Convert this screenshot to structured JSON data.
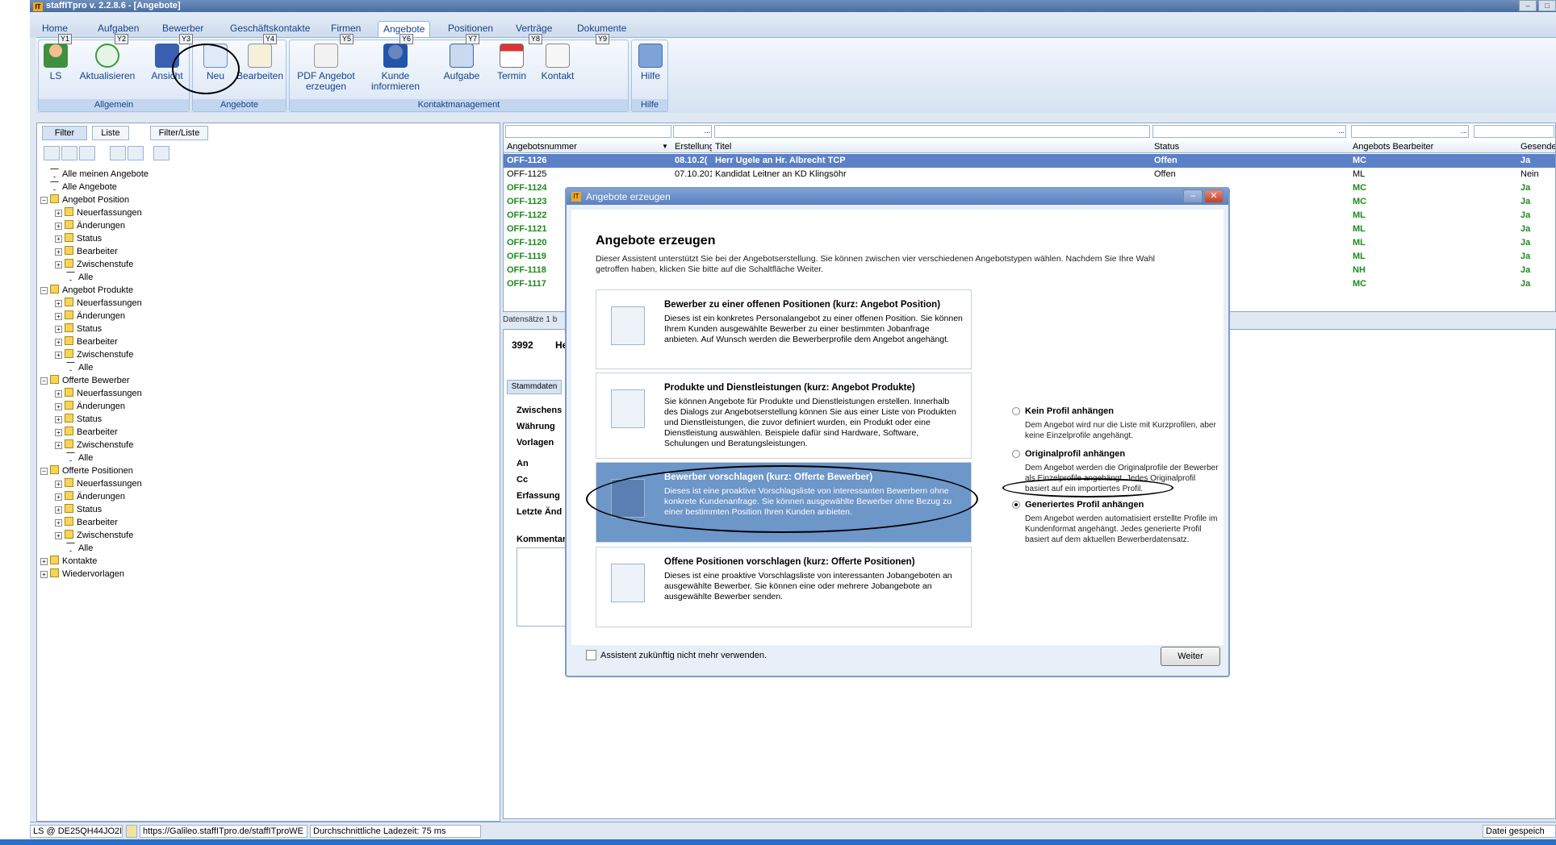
{
  "app": {
    "title": "staffITpro v. 2.2.8.6 - [Angebote]",
    "logo": "IT",
    "window_buttons": [
      "–",
      "□"
    ]
  },
  "menu": [
    "Home",
    "Aufgaben",
    "Bewerber",
    "Geschäftskontakte",
    "Firmen",
    "Angebote",
    "Positionen",
    "Verträge",
    "Dokumente"
  ],
  "menu_active": "Angebote",
  "ribbon": {
    "groups": [
      "Allgemein",
      "Angebote",
      "Kontaktmanagement",
      "Hilfe"
    ],
    "buttons": [
      {
        "label": "LS",
        "icon": "user-icon",
        "key": "Y1"
      },
      {
        "label": "Aktualisieren",
        "icon": "refresh-icon",
        "key": "Y2"
      },
      {
        "label": "Ansicht",
        "icon": "view-icon",
        "key": "Y3"
      },
      {
        "label": "Neu",
        "icon": "new-icon"
      },
      {
        "label": "Bearbeiten",
        "icon": "edit-icon",
        "key": "Y4"
      },
      {
        "label": "PDF Angebot erzeugen",
        "icon": "pdf-icon",
        "key": "Y5"
      },
      {
        "label": "Kunde informieren",
        "icon": "info-user-icon",
        "key": "Y6"
      },
      {
        "label": "Aufgabe",
        "icon": "task-icon",
        "key": "Y7"
      },
      {
        "label": "Termin",
        "icon": "calendar-icon",
        "key": "Y8"
      },
      {
        "label": "Kontakt",
        "icon": "contact-icon"
      },
      {
        "label": "Hilfe",
        "icon": "help-icon",
        "key": "Y9"
      }
    ]
  },
  "left": {
    "tabs": [
      "Filter",
      "Liste",
      "Filter/Liste"
    ],
    "tree": [
      {
        "label": "Alle meinen Angebote",
        "level": 0,
        "type": "funnel"
      },
      {
        "label": "Alle Angebote",
        "level": 0,
        "type": "funnel"
      },
      {
        "label": "Angebot Position",
        "level": 0,
        "type": "folder",
        "toggle": "−"
      },
      {
        "label": "Neuerfassungen",
        "level": 1,
        "type": "folder",
        "toggle": "+"
      },
      {
        "label": "Änderungen",
        "level": 1,
        "type": "folder",
        "toggle": "+"
      },
      {
        "label": "Status",
        "level": 1,
        "type": "folder",
        "toggle": "+"
      },
      {
        "label": "Bearbeiter",
        "level": 1,
        "type": "folder",
        "toggle": "+"
      },
      {
        "label": "Zwischenstufe",
        "level": 1,
        "type": "folder",
        "toggle": "+"
      },
      {
        "label": "Alle",
        "level": 1,
        "type": "funnel"
      },
      {
        "label": "Angebot Produkte",
        "level": 0,
        "type": "folder",
        "toggle": "−"
      },
      {
        "label": "Neuerfassungen",
        "level": 1,
        "type": "folder",
        "toggle": "+"
      },
      {
        "label": "Änderungen",
        "level": 1,
        "type": "folder",
        "toggle": "+"
      },
      {
        "label": "Status",
        "level": 1,
        "type": "folder",
        "toggle": "+"
      },
      {
        "label": "Bearbeiter",
        "level": 1,
        "type": "folder",
        "toggle": "+"
      },
      {
        "label": "Zwischenstufe",
        "level": 1,
        "type": "folder",
        "toggle": "+"
      },
      {
        "label": "Alle",
        "level": 1,
        "type": "funnel"
      },
      {
        "label": "Offerte Bewerber",
        "level": 0,
        "type": "folder",
        "toggle": "−"
      },
      {
        "label": "Neuerfassungen",
        "level": 1,
        "type": "folder",
        "toggle": "+"
      },
      {
        "label": "Änderungen",
        "level": 1,
        "type": "folder",
        "toggle": "+"
      },
      {
        "label": "Status",
        "level": 1,
        "type": "folder",
        "toggle": "+"
      },
      {
        "label": "Bearbeiter",
        "level": 1,
        "type": "folder",
        "toggle": "+"
      },
      {
        "label": "Zwischenstufe",
        "level": 1,
        "type": "folder",
        "toggle": "+"
      },
      {
        "label": "Alle",
        "level": 1,
        "type": "funnel"
      },
      {
        "label": "Offerte Positionen",
        "level": 0,
        "type": "folder",
        "toggle": "−"
      },
      {
        "label": "Neuerfassungen",
        "level": 1,
        "type": "folder",
        "toggle": "+"
      },
      {
        "label": "Änderungen",
        "level": 1,
        "type": "folder",
        "toggle": "+"
      },
      {
        "label": "Status",
        "level": 1,
        "type": "folder",
        "toggle": "+"
      },
      {
        "label": "Bearbeiter",
        "level": 1,
        "type": "folder",
        "toggle": "+"
      },
      {
        "label": "Zwischenstufe",
        "level": 1,
        "type": "folder",
        "toggle": "+"
      },
      {
        "label": "Alle",
        "level": 1,
        "type": "funnel"
      },
      {
        "label": "Kontakte",
        "level": 0,
        "type": "folder",
        "toggle": "+"
      },
      {
        "label": "Wiedervorlagen",
        "level": 0,
        "type": "folder",
        "toggle": "+"
      }
    ]
  },
  "grid": {
    "filter_button": "...",
    "headers": [
      "Angebotsnummer",
      "Erstellung",
      "Titel",
      "Status",
      "Angebots Bearbeiter",
      "Gesende"
    ],
    "rows": [
      {
        "nr": "OFF-1126",
        "date": "08.10.2(",
        "title": "Herr Ugele an Hr. Albrecht TCP",
        "status": "Offen",
        "bearb": "MC",
        "ges": "Ja",
        "style": "sel"
      },
      {
        "nr": "OFF-1125",
        "date": "07.10.201",
        "title": "Kandidat Leitner an KD Klingsöhr",
        "status": "Offen",
        "bearb": "ML",
        "ges": "Nein",
        "style": "plain"
      },
      {
        "nr": "OFF-1124",
        "date": "",
        "title": "",
        "status": "",
        "bearb": "MC",
        "ges": "Ja",
        "style": "green"
      },
      {
        "nr": "OFF-1123",
        "date": "",
        "title": "",
        "status": "",
        "bearb": "MC",
        "ges": "Ja",
        "style": "green"
      },
      {
        "nr": "OFF-1122",
        "date": "",
        "title": "",
        "status": "",
        "bearb": "ML",
        "ges": "Ja",
        "style": "green"
      },
      {
        "nr": "OFF-1121",
        "date": "",
        "title": "",
        "status": "",
        "bearb": "ML",
        "ges": "Ja",
        "style": "green"
      },
      {
        "nr": "OFF-1120",
        "date": "",
        "title": "",
        "status": "",
        "bearb": "ML",
        "ges": "Ja",
        "style": "green"
      },
      {
        "nr": "OFF-1119",
        "date": "",
        "title": "",
        "status": "",
        "bearb": "ML",
        "ges": "Ja",
        "style": "green"
      },
      {
        "nr": "OFF-1118",
        "date": "",
        "title": "",
        "status": "",
        "bearb": "NH",
        "ges": "Ja",
        "style": "green"
      },
      {
        "nr": "OFF-1117",
        "date": "",
        "title": "",
        "status": "",
        "bearb": "MC",
        "ges": "Ja",
        "style": "green"
      }
    ],
    "footer": "Datensätze 1 b"
  },
  "detail": {
    "id": "3992",
    "name": "He",
    "tab": "Stammdaten",
    "labels": [
      "Zwischens",
      "Währung",
      "Vorlagen",
      "An",
      "Cc",
      "Erfassung",
      "Letzte Änd",
      "Kommentar"
    ]
  },
  "status": {
    "user": "LS @ DE25QH44JO2I",
    "url": "https://Galileo.staffITpro.de/staffITproWE",
    "load": "Durchschnittliche Ladezeit: 75 ms",
    "saved": "Datei gespeich"
  },
  "dialog": {
    "title": "Angebote erzeugen",
    "heading": "Angebote erzeugen",
    "intro": "Dieser Assistent unterstützt Sie bei der Angebotserstellung. Sie können zwischen vier verschiedenen Angebotstypen wählen. Nachdem Sie Ihre Wahl getroffen haben, klicken Sie bitte auf die Schaltfläche Weiter.",
    "options": [
      {
        "title": "Bewerber zu einer offenen Positionen (kurz: Angebot Position)",
        "desc": "Dieses ist ein konkretes Personalangebot zu einer offenen Position. Sie können Ihrem Kunden ausgewählte Bewerber zu einer bestimmten Jobanfrage anbieten. Auf Wunsch werden die Bewerberprofile dem Angebot angehängt."
      },
      {
        "title": "Produkte und Dienstleistungen (kurz: Angebot Produkte)",
        "desc": "Sie können Angebote für Produkte und Dienstleistungen erstellen. Innerhalb des Dialogs zur Angebotserstellung können Sie aus einer Liste von Produkten und Dienstleistungen, die zuvor definiert wurden, ein Produkt oder eine Dienstleistung auswählen. Beispiele dafür sind Hardware, Software, Schulungen und Beratungsleistungen."
      },
      {
        "title": "Bewerber vorschlagen (kurz: Offerte Bewerber)",
        "desc": "Dieses ist eine proaktive Vorschlagsliste von interessanten Bewerbern ohne konkrete Kundenanfrage. Sie können ausgewählte Bewerber ohne Bezug zu einer bestimmten Position Ihren Kunden anbieten."
      },
      {
        "title": "Offene Positionen vorschlagen (kurz: Offerte Positionen)",
        "desc": "Dieses ist eine proaktive Vorschlagsliste von interessanten Jobangeboten an ausgewählte Bewerber. Sie können eine oder mehrere Jobangebote an ausgewählte Bewerber senden."
      }
    ],
    "selected_option": 2,
    "profile_options": [
      {
        "label": "Kein Profil anhängen",
        "desc": "Dem Angebot wird nur die Liste mit Kurzprofilen, aber keine Einzelprofile angehängt."
      },
      {
        "label": "Originalprofil anhängen",
        "desc": "Dem Angebot werden die Originalprofile der Bewerber als Einzelprofile angehängt. Jedes Originalprofil basiert auf ein importiertes Profil."
      },
      {
        "label": "Generiertes Profil anhängen",
        "desc": "Dem Angebot werden automatisiert erstellte Profile im Kundenformat angehängt. Jedes generierte Profil basiert auf dem aktuellen Bewerberdatensatz."
      }
    ],
    "selected_profile": 2,
    "checkbox_label": "Assistent zukünftig nicht mehr verwenden.",
    "next_button": "Weiter",
    "close": "✕",
    "minimize": "–"
  },
  "colors": {
    "accent": "#15428b",
    "selected_row": "#5b80c6",
    "selected_option": "#6d96c9",
    "green_text": "#1b8c1b"
  }
}
